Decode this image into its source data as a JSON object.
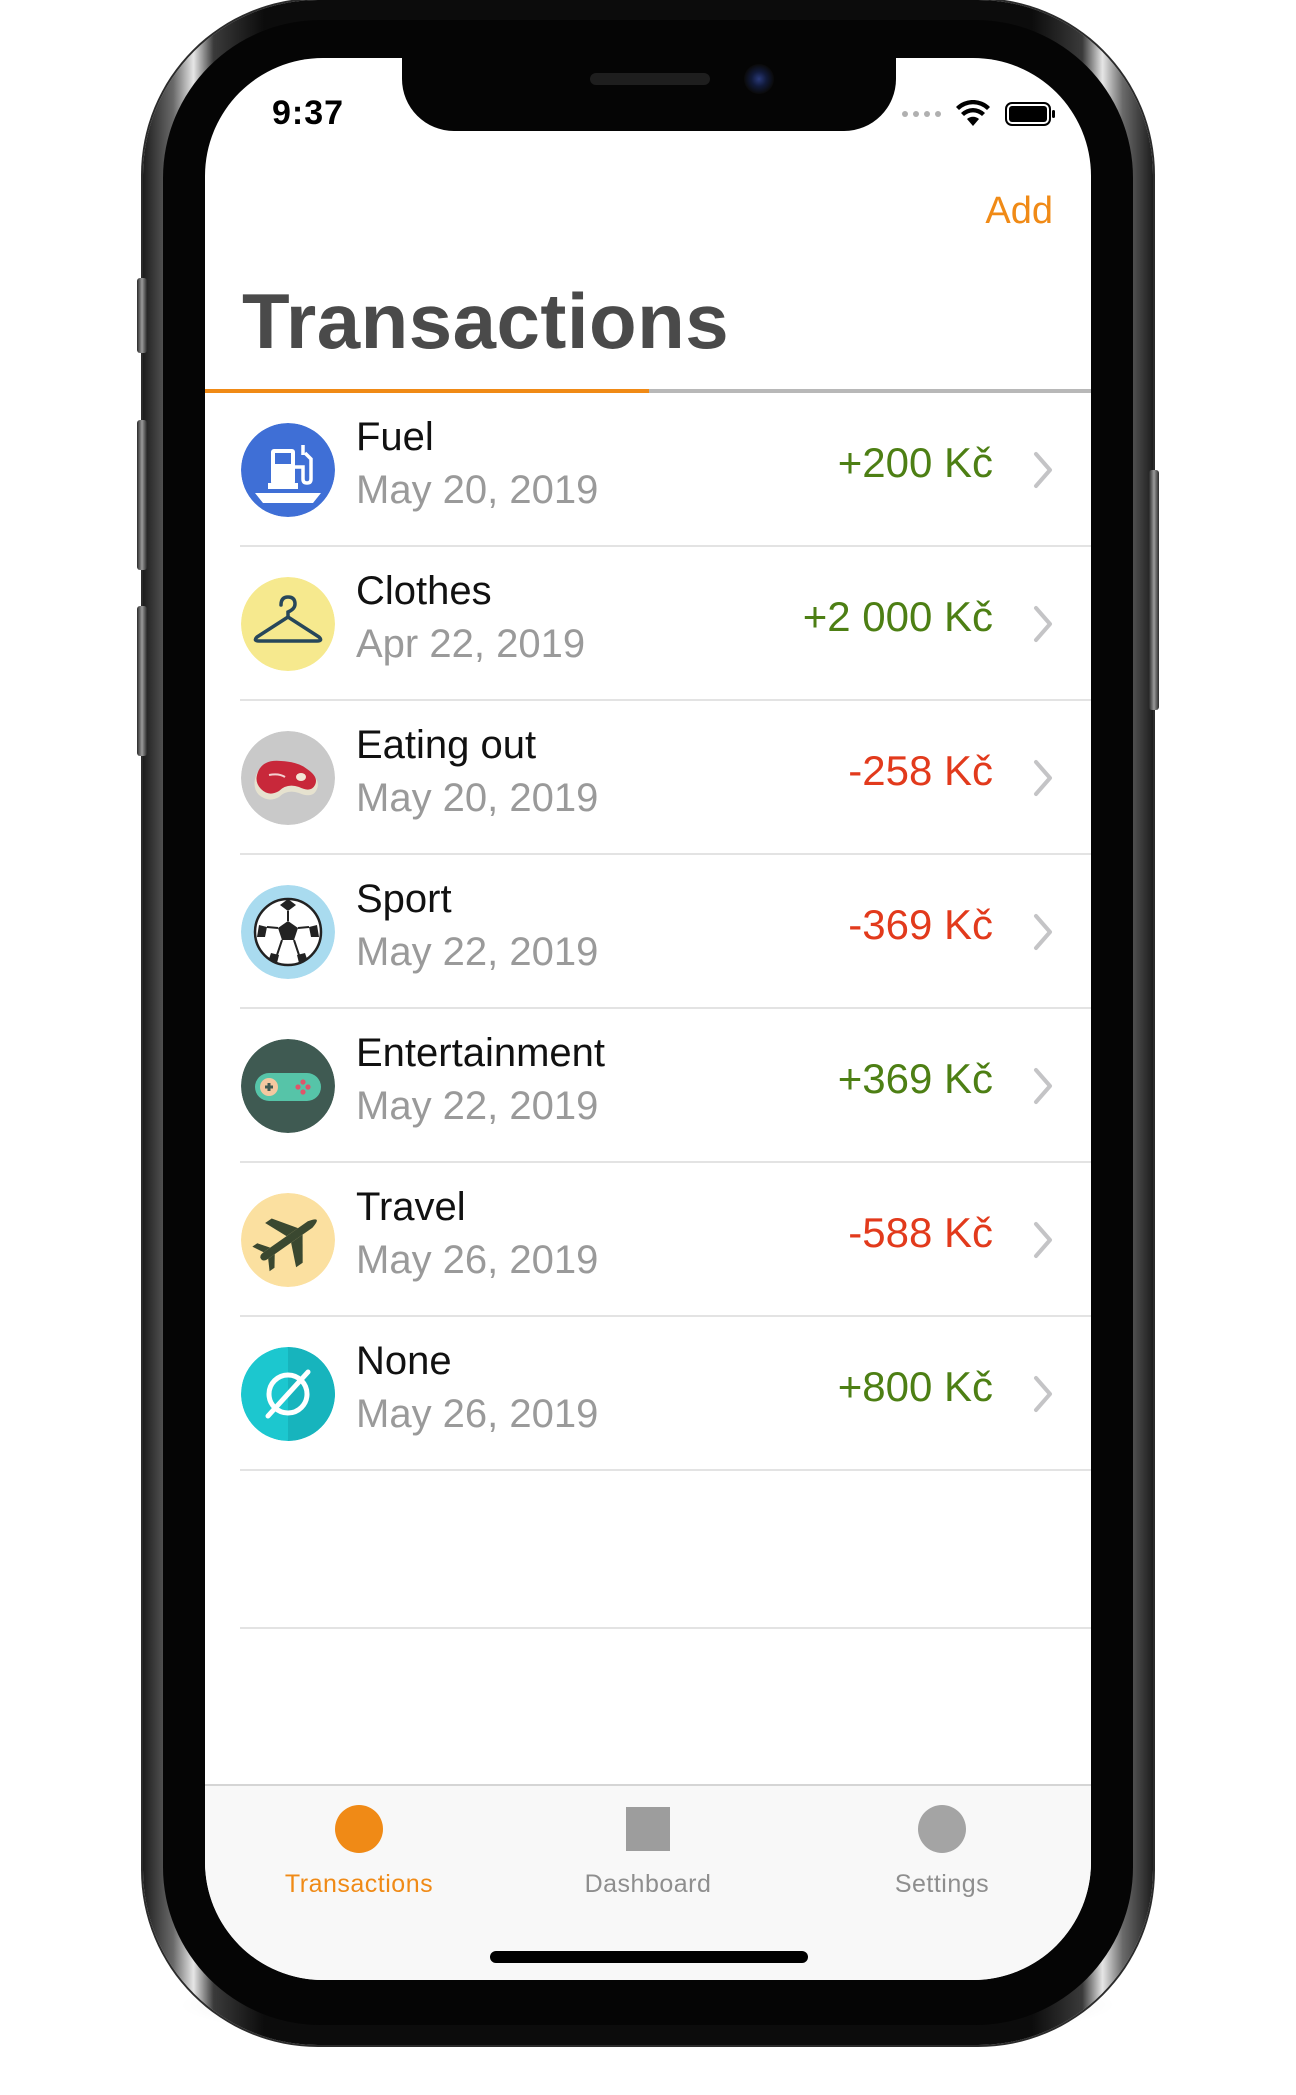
{
  "status_bar": {
    "time": "9:37",
    "icons": [
      "signal-dots-icon",
      "wifi-icon",
      "battery-icon"
    ]
  },
  "nav": {
    "add_label": "Add",
    "title": "Transactions"
  },
  "colors": {
    "accent": "#f08a16",
    "positive": "#4d7f14",
    "negative": "#e23a1c",
    "secondary_text": "#9a9a9a"
  },
  "transactions": [
    {
      "name": "Fuel",
      "date": "May 20, 2019",
      "amount": "+200 Kč",
      "sign": "pos",
      "icon": "fuel-pump-icon",
      "icon_bg": "#3f6fd6"
    },
    {
      "name": "Clothes",
      "date": "Apr 22, 2019",
      "amount": "+2 000 Kč",
      "sign": "pos",
      "icon": "hanger-icon",
      "icon_bg": "#f6e98e"
    },
    {
      "name": "Eating out",
      "date": "May 20, 2019",
      "amount": "-258 Kč",
      "sign": "neg",
      "icon": "steak-icon",
      "icon_bg": "#c9c9c9"
    },
    {
      "name": "Sport",
      "date": "May 22, 2019",
      "amount": "-369 Kč",
      "sign": "neg",
      "icon": "soccer-ball-icon",
      "icon_bg": "#a9dbef"
    },
    {
      "name": "Entertainment",
      "date": "May 22, 2019",
      "amount": "+369 Kč",
      "sign": "pos",
      "icon": "gamepad-icon",
      "icon_bg": "#3f5a52"
    },
    {
      "name": "Travel",
      "date": "May 26, 2019",
      "amount": "-588 Kč",
      "sign": "neg",
      "icon": "airplane-icon",
      "icon_bg": "#fbe0a0"
    },
    {
      "name": "None",
      "date": "May 26, 2019",
      "amount": "+800 Kč",
      "sign": "pos",
      "icon": "empty-set-icon",
      "icon_bg": "#1cc7cf"
    }
  ],
  "tabbar": {
    "items": [
      {
        "label": "Transactions",
        "icon": "circle-icon",
        "selected": true
      },
      {
        "label": "Dashboard",
        "icon": "square-icon",
        "selected": false
      },
      {
        "label": "Settings",
        "icon": "circle-icon",
        "selected": false
      }
    ]
  }
}
